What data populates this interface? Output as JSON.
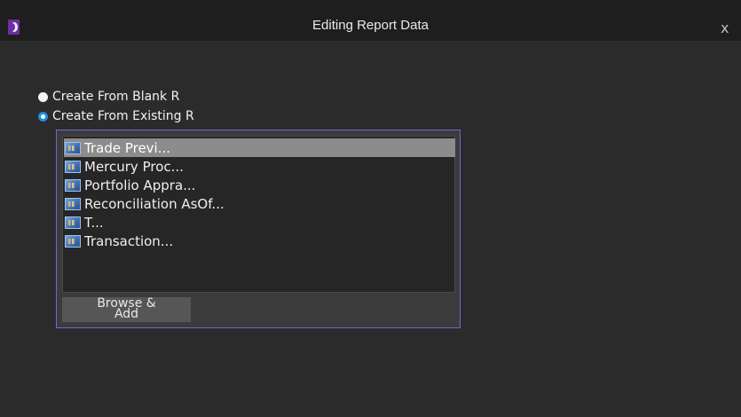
{
  "window": {
    "title": "Editing Report Data",
    "close_glyph": "x",
    "app_icon": "moon-logo-icon"
  },
  "options": [
    {
      "label": "Create From Blank R",
      "selected": false
    },
    {
      "label": "Create From Existing R",
      "selected": true
    }
  ],
  "reports": {
    "items": [
      {
        "label": "Trade Previ...",
        "icon": "report-icon",
        "selected": true
      },
      {
        "label": "Mercury Proc...",
        "icon": "report-icon",
        "selected": false
      },
      {
        "label": "Portfolio Appra...",
        "icon": "report-icon",
        "selected": false
      },
      {
        "label": "Reconciliation AsOf...",
        "icon": "report-icon",
        "selected": false
      },
      {
        "label": "T...",
        "icon": "report-icon",
        "selected": false
      },
      {
        "label": "Transaction...",
        "icon": "report-icon",
        "selected": false
      }
    ]
  },
  "browse_button": {
    "line1": "Browse &",
    "line2": "Add"
  },
  "colors": {
    "background": "#2b2b2b",
    "titlebar": "#1e1e1e",
    "accent_radio": "#1f8fe0",
    "list_border": "#6a6ad0",
    "selected_row": "#8c8c8c"
  }
}
